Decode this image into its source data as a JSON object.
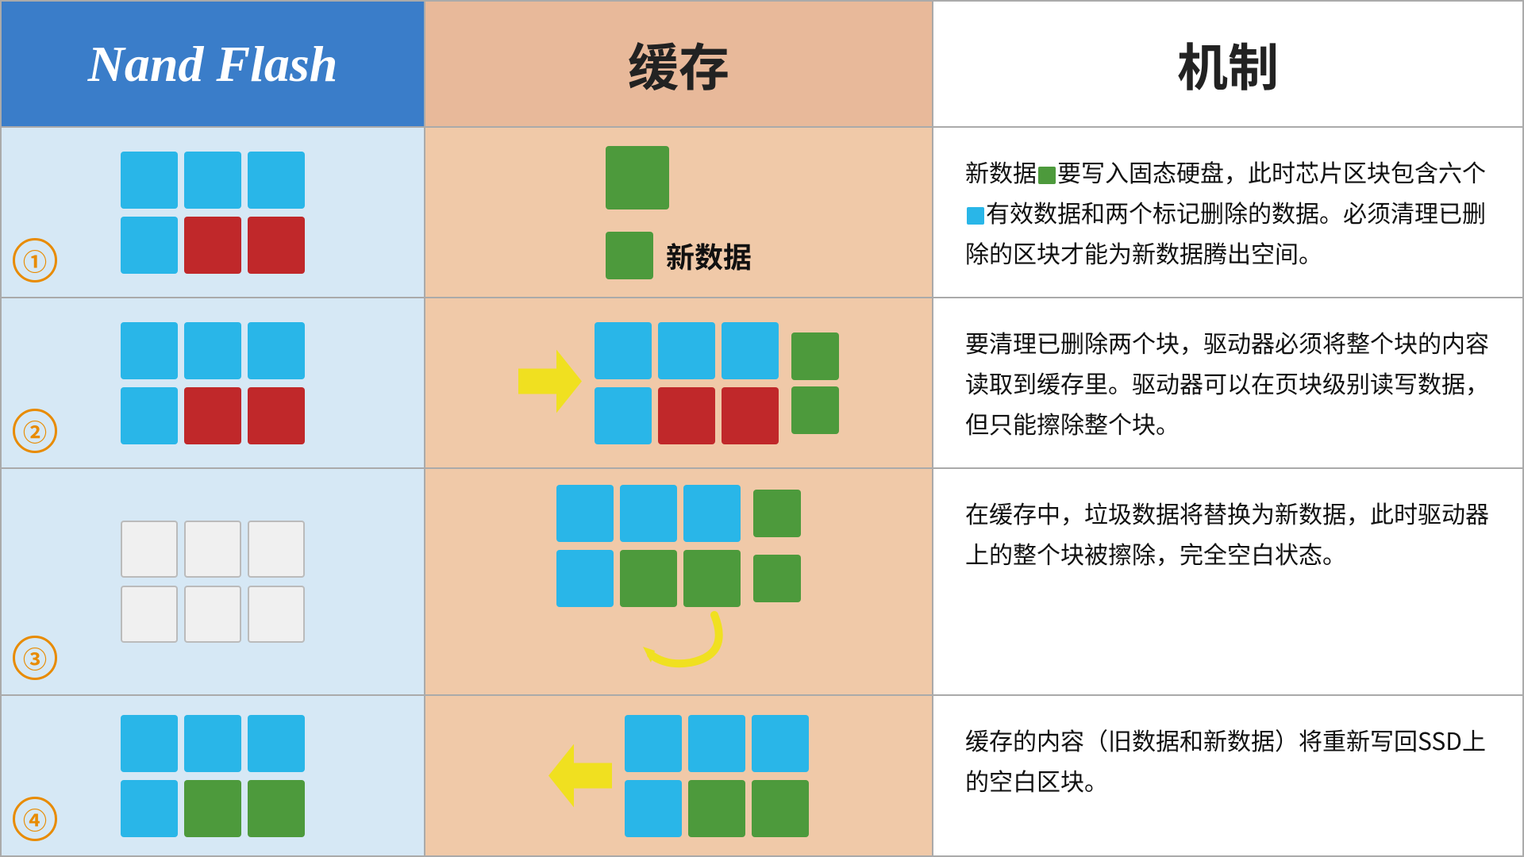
{
  "header": {
    "nand_label": "Nand Flash",
    "cache_label": "缓存",
    "mechanism_label": "机制"
  },
  "steps": [
    {
      "number": "①",
      "mechanism_text_parts": [
        "新数据",
        "要写入固态硬盘，此时芯片区块包含六个",
        "有效数据和两个标记删除的数据。必须清理已删除的区块才能为新数据腾出空间。"
      ]
    },
    {
      "number": "②",
      "mechanism_text": "要清理已删除两个块，驱动器必须将整个块的内容读取到缓存里。驱动器可以在页块级别读写数据，但只能擦除整个块。"
    },
    {
      "number": "③",
      "mechanism_text": "在缓存中，垃圾数据将替换为新数据，此时驱动器上的整个块被擦除，完全空白状态。"
    },
    {
      "number": "④",
      "mechanism_text": "缓存的内容（旧数据和新数据）将重新写回SSD上的空白区块。"
    }
  ],
  "legend": {
    "label": "新数据"
  }
}
